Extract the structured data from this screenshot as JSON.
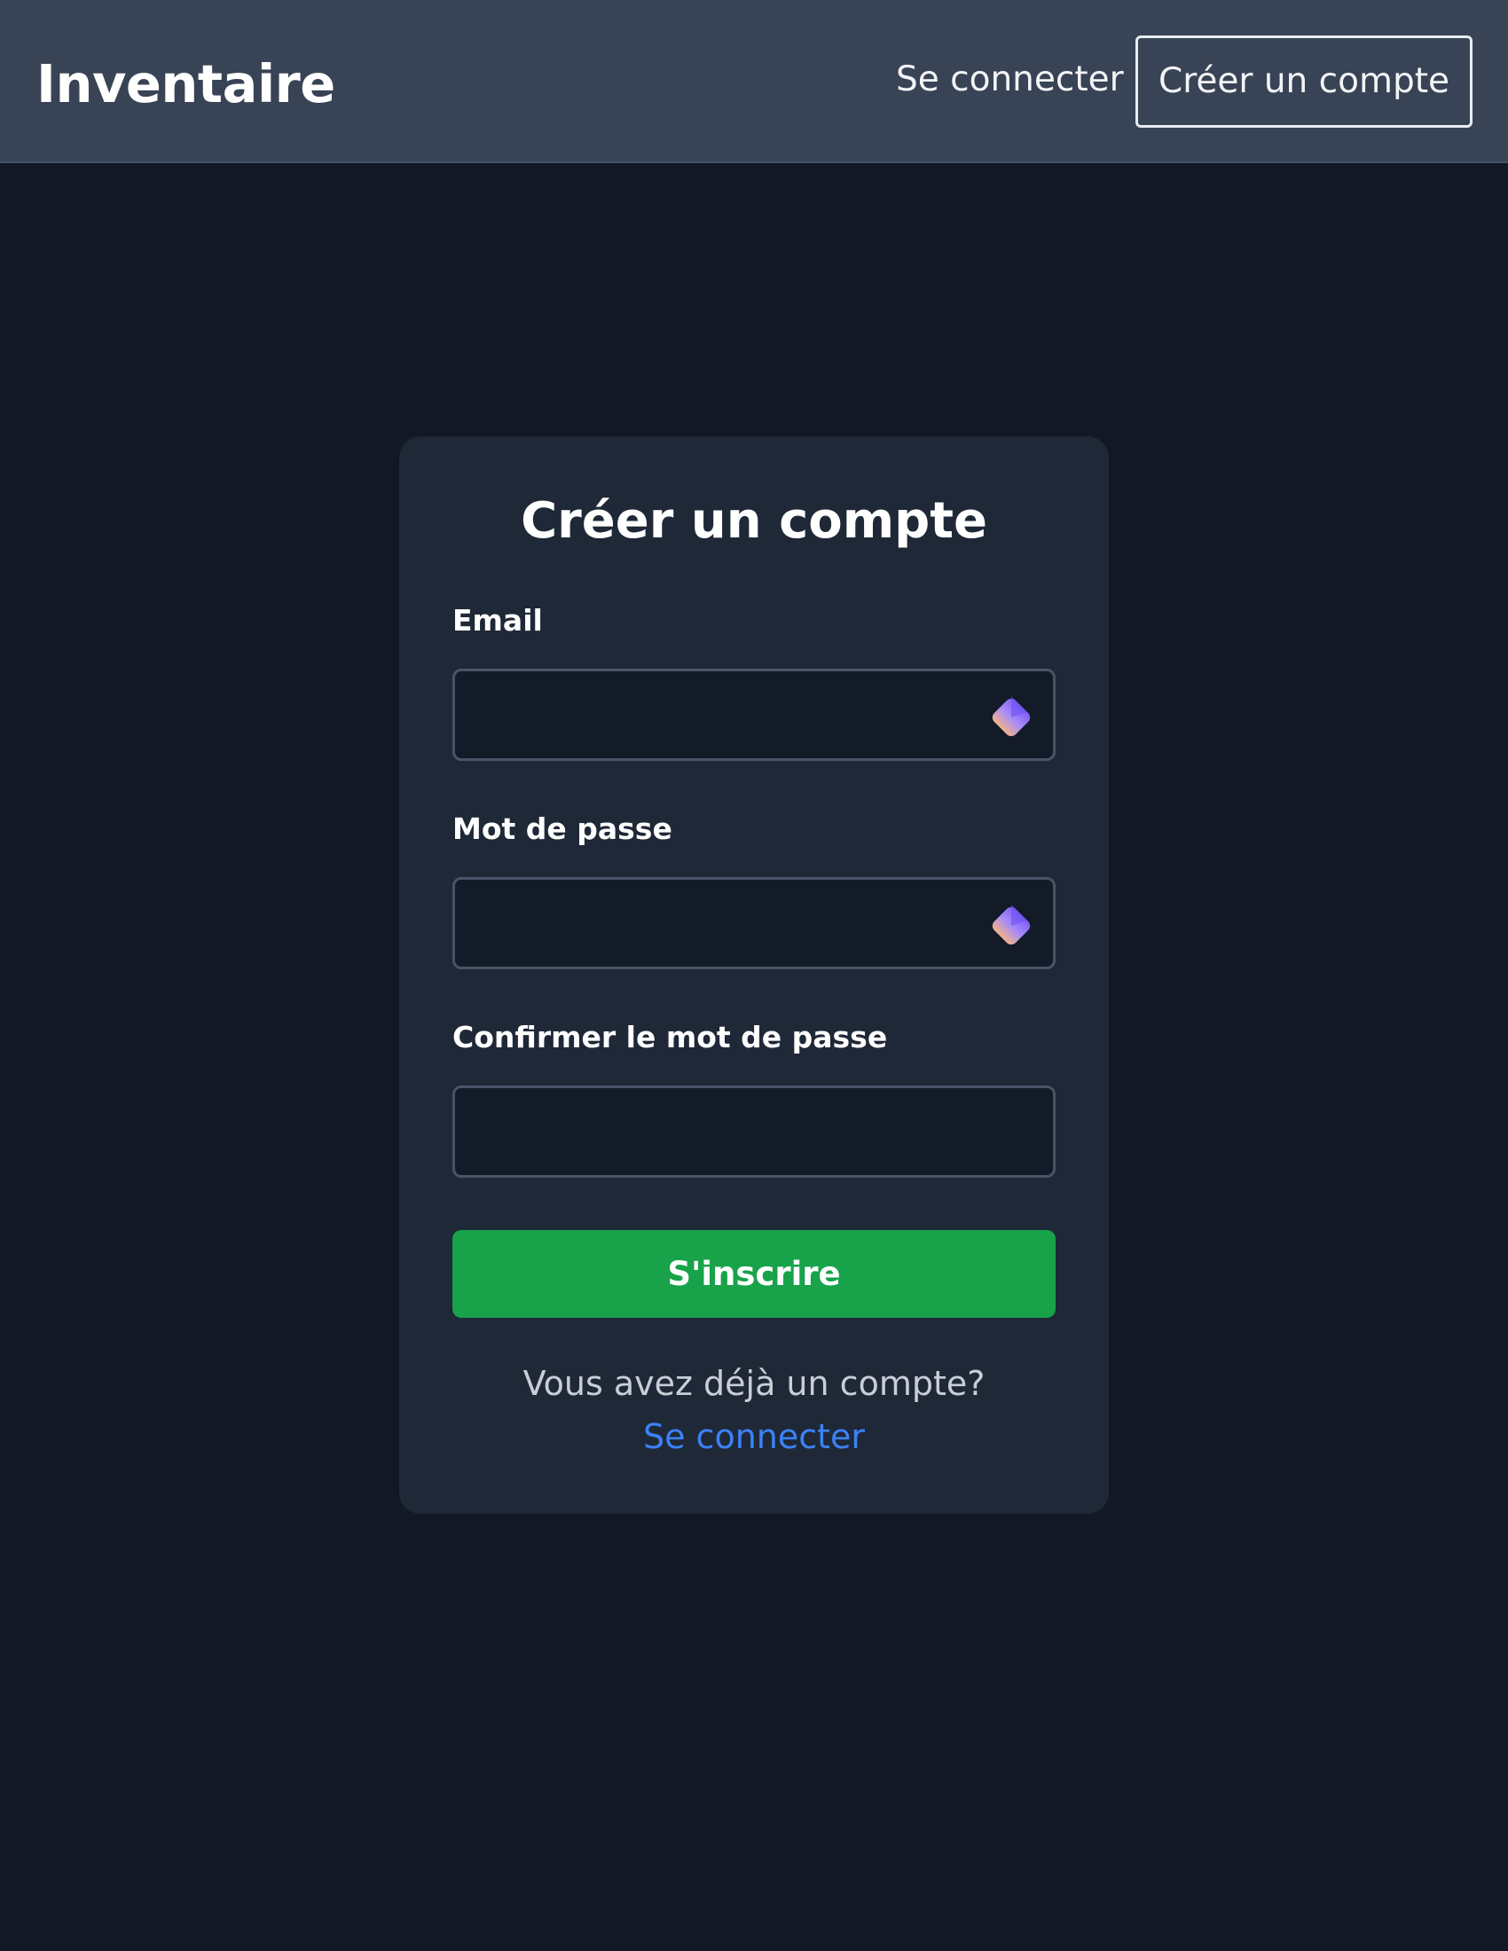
{
  "header": {
    "brand": "Inventaire",
    "login_link": "Se connecter",
    "register_button": "Créer un compte"
  },
  "form": {
    "title": "Créer un compte",
    "email_label": "Email",
    "email_value": "",
    "password_label": "Mot de passe",
    "password_value": "",
    "confirm_label": "Confirmer le mot de passe",
    "confirm_value": "",
    "submit_label": "S'inscrire",
    "footer_text": "Vous avez déjà un compte?",
    "footer_link": "Se connecter"
  },
  "icons": {
    "password_manager_icon": "password-manager-icon"
  },
  "colors": {
    "background": "#121826",
    "header": "#384355",
    "card": "#1f2837",
    "input": "#131a28",
    "submit": "#18a34a",
    "link": "#3b82f6"
  }
}
